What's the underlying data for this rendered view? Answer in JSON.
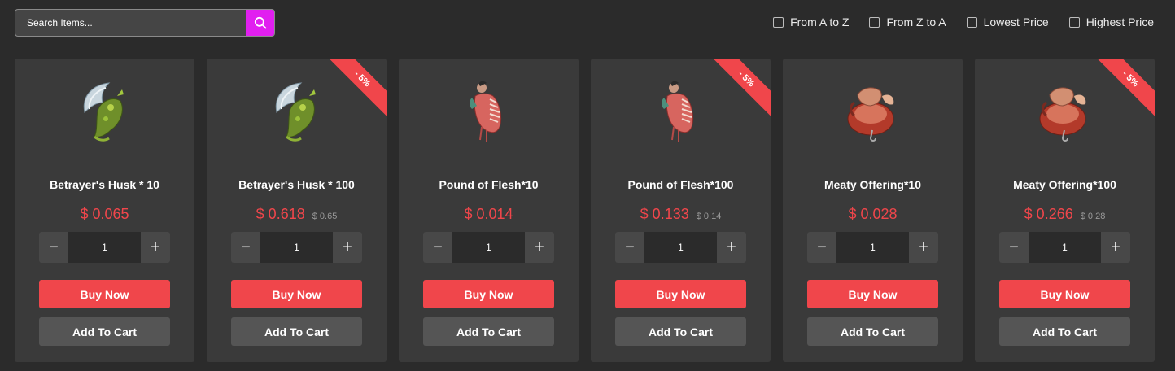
{
  "search": {
    "placeholder": "Search Items...",
    "icon": "search-icon",
    "button_color": "#e11ff0"
  },
  "sort_options": [
    {
      "label": "From A to Z",
      "checked": false
    },
    {
      "label": "From Z to A",
      "checked": false
    },
    {
      "label": "Lowest Price",
      "checked": false
    },
    {
      "label": "Highest Price",
      "checked": false
    }
  ],
  "colors": {
    "accent": "#f0464b",
    "card": "#3a3a3a",
    "background": "#2b2b2b"
  },
  "products": [
    {
      "name": "Betrayer's Husk * 10",
      "price": "$ 0.065",
      "old_price": "",
      "discount": "",
      "quantity": "1",
      "icon": "betrayers-husk-icon",
      "buy_label": "Buy Now",
      "cart_label": "Add To Cart"
    },
    {
      "name": "Betrayer's Husk * 100",
      "price": "$ 0.618",
      "old_price": "$ 0.65",
      "discount": "- 5%",
      "quantity": "1",
      "icon": "betrayers-husk-icon",
      "buy_label": "Buy Now",
      "cart_label": "Add To Cart"
    },
    {
      "name": "Pound of Flesh*10",
      "price": "$ 0.014",
      "old_price": "",
      "discount": "",
      "quantity": "1",
      "icon": "pound-of-flesh-icon",
      "buy_label": "Buy Now",
      "cart_label": "Add To Cart"
    },
    {
      "name": "Pound of Flesh*100",
      "price": "$ 0.133",
      "old_price": "$ 0.14",
      "discount": "- 5%",
      "quantity": "1",
      "icon": "pound-of-flesh-icon",
      "buy_label": "Buy Now",
      "cart_label": "Add To Cart"
    },
    {
      "name": "Meaty Offering*10",
      "price": "$ 0.028",
      "old_price": "",
      "discount": "",
      "quantity": "1",
      "icon": "meaty-offering-icon",
      "buy_label": "Buy Now",
      "cart_label": "Add To Cart"
    },
    {
      "name": "Meaty Offering*100",
      "price": "$ 0.266",
      "old_price": "$ 0.28",
      "discount": "- 5%",
      "quantity": "1",
      "icon": "meaty-offering-icon",
      "buy_label": "Buy Now",
      "cart_label": "Add To Cart"
    }
  ]
}
